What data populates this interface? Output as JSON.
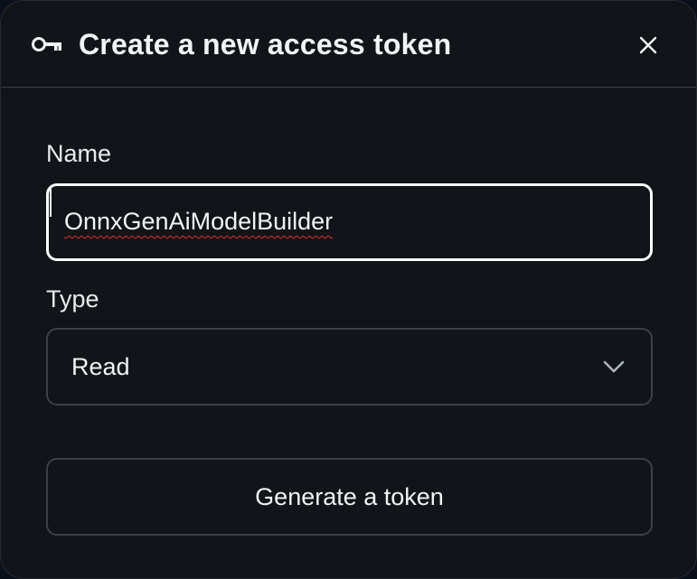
{
  "dialog": {
    "title": "Create a new access token",
    "title_icon": "key-icon",
    "close_icon": "close-icon"
  },
  "form": {
    "name_label": "Name",
    "name_value": "OnnxGenAiModelBuilder",
    "type_label": "Type",
    "type_value": "Read",
    "type_icon": "chevron-down-icon",
    "submit_label": "Generate a token"
  },
  "colors": {
    "dialog_bg": "#111418",
    "text": "#f1f3f5",
    "focused_border": "#ffffff",
    "border": "#3c4149",
    "spellcheck": "#e03131"
  }
}
